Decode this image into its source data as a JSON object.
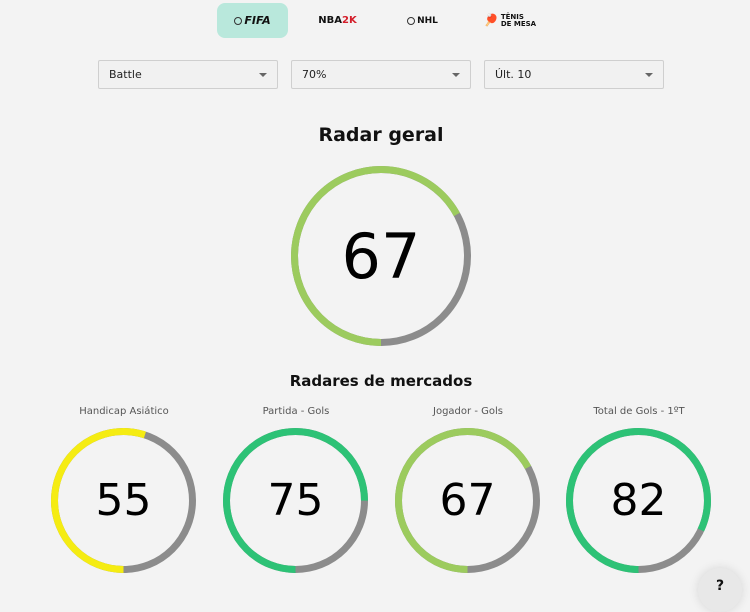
{
  "tabs": [
    {
      "label": "FIFA",
      "active": true
    },
    {
      "label_a": "NBA",
      "label_b": "2K",
      "active": false
    },
    {
      "label": "NHL",
      "active": false
    },
    {
      "label_a": "TÊNIS",
      "label_b": "DE MESA",
      "active": false
    }
  ],
  "filters": {
    "league": "Battle",
    "threshold": "70%",
    "games": "Últ. 10"
  },
  "overall": {
    "title": "Radar geral",
    "value": 67,
    "color": "#9ccb5e"
  },
  "markets": {
    "title": "Radares de mercados",
    "items": [
      {
        "label": "Handicap Asiático",
        "value": 55,
        "color": "#f5ec12"
      },
      {
        "label": "Partida - Gols",
        "value": 75,
        "color": "#2dc276"
      },
      {
        "label": "Jogador - Gols",
        "value": 67,
        "color": "#9ccb5e"
      },
      {
        "label": "Total de Gols - 1ºT",
        "value": 82,
        "color": "#2dc276"
      }
    ]
  },
  "track_color": "#8c8c8c",
  "help": {
    "label": "?"
  }
}
